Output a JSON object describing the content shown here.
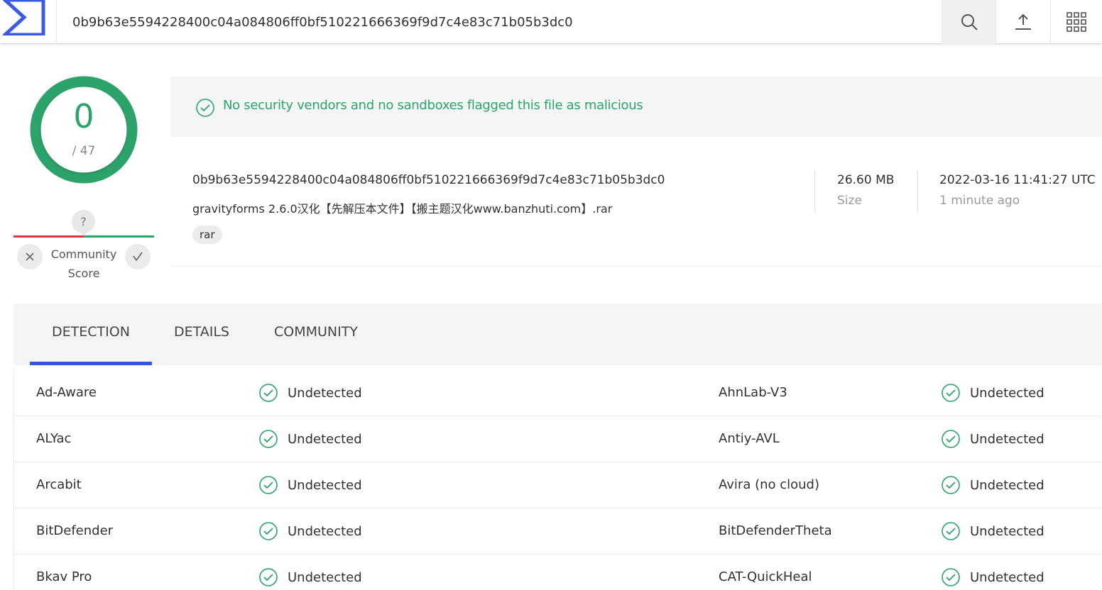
{
  "header": {
    "search_value": "0b9b63e5594228400c04a084806ff0bf510221666369f9d7c4e83c71b05b3dc0",
    "icons": [
      "virustotal-logo",
      "search-icon",
      "upload-icon",
      "apps-grid-icon"
    ]
  },
  "score": {
    "detections": "0",
    "total": "/ 47",
    "community_badge": "?",
    "community_label_1": "Community",
    "community_label_2": "Score"
  },
  "summary": {
    "verdict": "No security vendors and no sandboxes flagged this file as malicious",
    "hash": "0b9b63e5594228400c04a084806ff0bf510221666369f9d7c4e83c71b05b3dc0",
    "file_name": "gravityforms 2.6.0汉化【先解压本文件】【搬主题汉化www.banzhuti.com】.rar",
    "tag": "rar",
    "size_value": "26.60 MB",
    "size_label": "Size",
    "date_value": "2022-03-16 11:41:27 UTC",
    "date_relative": "1 minute ago"
  },
  "tabs": [
    {
      "label": "DETECTION",
      "active": true
    },
    {
      "label": "DETAILS",
      "active": false
    },
    {
      "label": "COMMUNITY",
      "active": false
    }
  ],
  "detections": [
    {
      "left_engine": "Ad-Aware",
      "left_result": "Undetected",
      "right_engine": "AhnLab-V3",
      "right_result": "Undetected"
    },
    {
      "left_engine": "ALYac",
      "left_result": "Undetected",
      "right_engine": "Antiy-AVL",
      "right_result": "Undetected"
    },
    {
      "left_engine": "Arcabit",
      "left_result": "Undetected",
      "right_engine": "Avira (no cloud)",
      "right_result": "Undetected"
    },
    {
      "left_engine": "BitDefender",
      "left_result": "Undetected",
      "right_engine": "BitDefenderTheta",
      "right_result": "Undetected"
    },
    {
      "left_engine": "Bkav Pro",
      "left_result": "Undetected",
      "right_engine": "CAT-QuickHeal",
      "right_result": "Undetected"
    }
  ],
  "colors": {
    "clean_green": "#2ca36a",
    "malicious_red": "#e0343d",
    "brand_blue": "#3455e0",
    "panel_gray": "#f5f5f5"
  }
}
